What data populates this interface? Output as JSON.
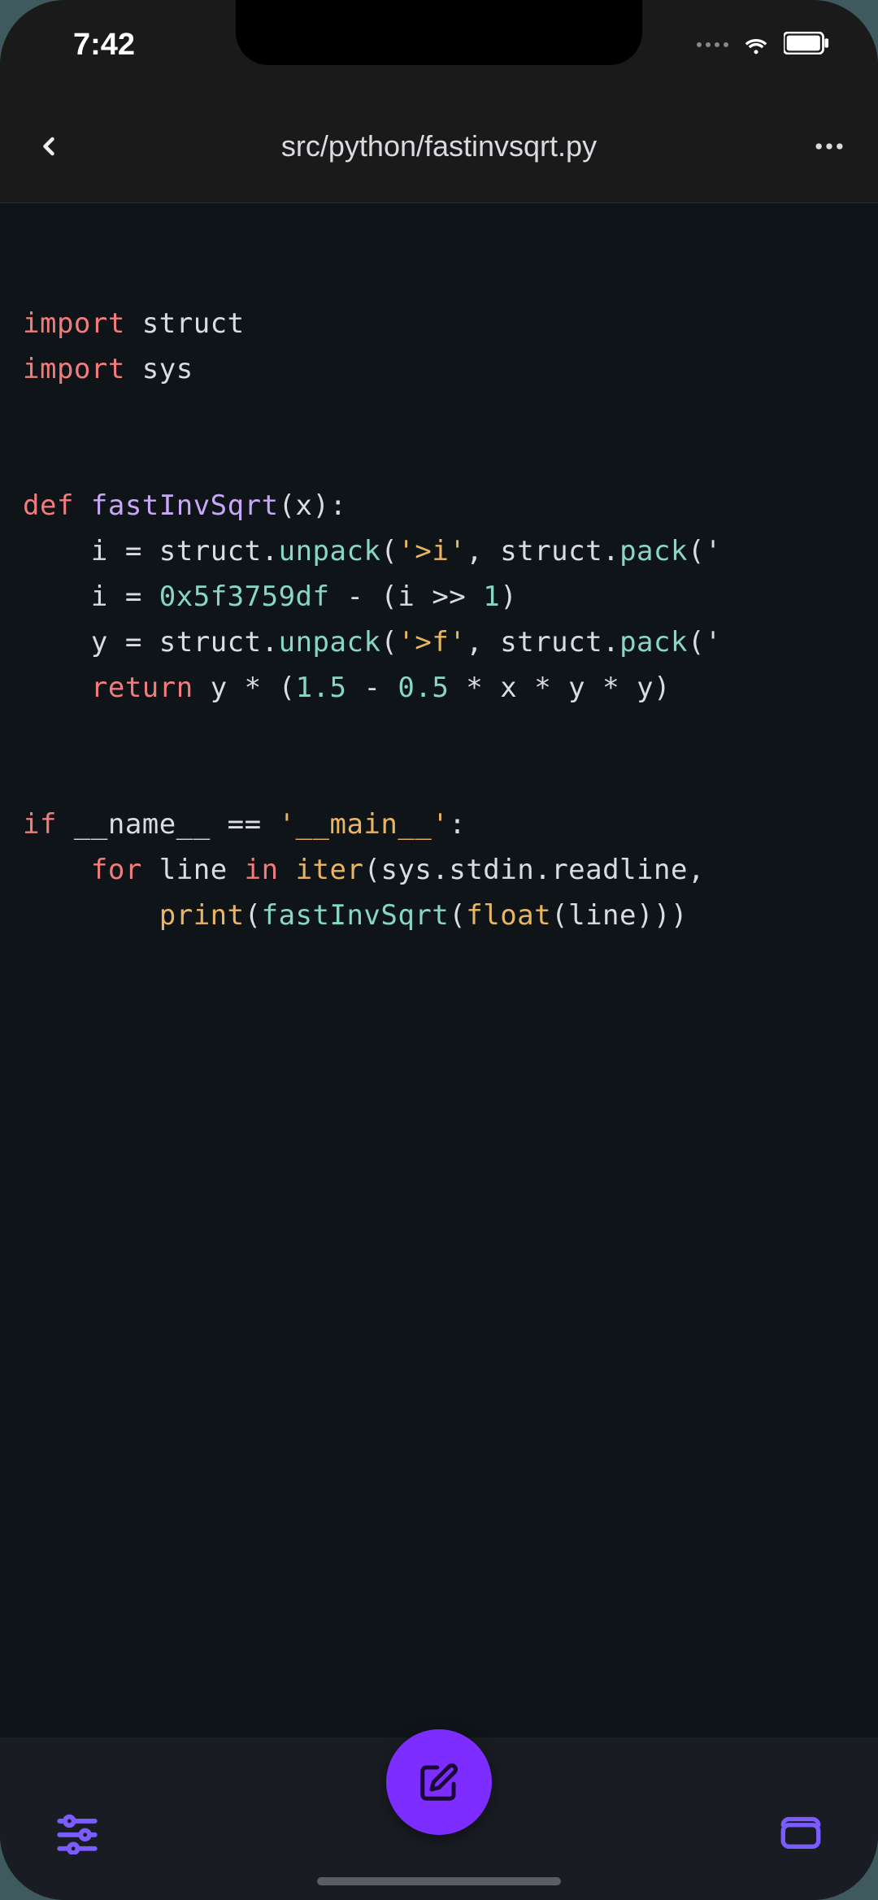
{
  "status": {
    "time": "7:42"
  },
  "nav": {
    "title": "src/python/fastinvsqrt.py"
  },
  "code": {
    "lines": [
      [
        {
          "t": "kw-import",
          "v": "import"
        },
        {
          "t": "ident",
          "v": " struct"
        }
      ],
      [
        {
          "t": "kw-import",
          "v": "import"
        },
        {
          "t": "ident",
          "v": " sys"
        }
      ],
      [],
      [],
      [
        {
          "t": "kw-def",
          "v": "def "
        },
        {
          "t": "func",
          "v": "fastInvSqrt"
        },
        {
          "t": "punct",
          "v": "("
        },
        {
          "t": "ident",
          "v": "x"
        },
        {
          "t": "punct",
          "v": "):"
        }
      ],
      [
        {
          "t": "ident",
          "v": "    i "
        },
        {
          "t": "punct",
          "v": "= "
        },
        {
          "t": "ident",
          "v": "struct"
        },
        {
          "t": "punct",
          "v": "."
        },
        {
          "t": "call",
          "v": "unpack"
        },
        {
          "t": "punct",
          "v": "("
        },
        {
          "t": "str",
          "v": "'>i'"
        },
        {
          "t": "punct",
          "v": ", "
        },
        {
          "t": "ident",
          "v": "struct"
        },
        {
          "t": "punct",
          "v": "."
        },
        {
          "t": "call",
          "v": "pack"
        },
        {
          "t": "punct",
          "v": "('"
        }
      ],
      [
        {
          "t": "ident",
          "v": "    i "
        },
        {
          "t": "punct",
          "v": "= "
        },
        {
          "t": "num",
          "v": "0x5f3759df"
        },
        {
          "t": "punct",
          "v": " - ("
        },
        {
          "t": "ident",
          "v": "i "
        },
        {
          "t": "punct",
          "v": ">> "
        },
        {
          "t": "num",
          "v": "1"
        },
        {
          "t": "punct",
          "v": ")"
        }
      ],
      [
        {
          "t": "ident",
          "v": "    y "
        },
        {
          "t": "punct",
          "v": "= "
        },
        {
          "t": "ident",
          "v": "struct"
        },
        {
          "t": "punct",
          "v": "."
        },
        {
          "t": "call",
          "v": "unpack"
        },
        {
          "t": "punct",
          "v": "("
        },
        {
          "t": "str",
          "v": "'>f'"
        },
        {
          "t": "punct",
          "v": ", "
        },
        {
          "t": "ident",
          "v": "struct"
        },
        {
          "t": "punct",
          "v": "."
        },
        {
          "t": "call",
          "v": "pack"
        },
        {
          "t": "punct",
          "v": "('"
        }
      ],
      [
        {
          "t": "ident",
          "v": "    "
        },
        {
          "t": "kw-return",
          "v": "return"
        },
        {
          "t": "ident",
          "v": " y "
        },
        {
          "t": "punct",
          "v": "* ("
        },
        {
          "t": "num",
          "v": "1.5"
        },
        {
          "t": "punct",
          "v": " - "
        },
        {
          "t": "num",
          "v": "0.5"
        },
        {
          "t": "punct",
          "v": " * "
        },
        {
          "t": "ident",
          "v": "x "
        },
        {
          "t": "punct",
          "v": "* "
        },
        {
          "t": "ident",
          "v": "y "
        },
        {
          "t": "punct",
          "v": "* "
        },
        {
          "t": "ident",
          "v": "y"
        },
        {
          "t": "punct",
          "v": ")"
        }
      ],
      [],
      [],
      [
        {
          "t": "kw-if",
          "v": "if"
        },
        {
          "t": "ident",
          "v": " __name__ "
        },
        {
          "t": "punct",
          "v": "== "
        },
        {
          "t": "str",
          "v": "'__main__'"
        },
        {
          "t": "punct",
          "v": ":"
        }
      ],
      [
        {
          "t": "ident",
          "v": "    "
        },
        {
          "t": "kw-for",
          "v": "for"
        },
        {
          "t": "ident",
          "v": " line "
        },
        {
          "t": "kw-in",
          "v": "in"
        },
        {
          "t": "ident",
          "v": " "
        },
        {
          "t": "builtin",
          "v": "iter"
        },
        {
          "t": "punct",
          "v": "("
        },
        {
          "t": "ident",
          "v": "sys"
        },
        {
          "t": "punct",
          "v": "."
        },
        {
          "t": "ident",
          "v": "stdin"
        },
        {
          "t": "punct",
          "v": "."
        },
        {
          "t": "ident",
          "v": "readline"
        },
        {
          "t": "punct",
          "v": ","
        }
      ],
      [
        {
          "t": "ident",
          "v": "        "
        },
        {
          "t": "builtin",
          "v": "print"
        },
        {
          "t": "punct",
          "v": "("
        },
        {
          "t": "call",
          "v": "fastInvSqrt"
        },
        {
          "t": "punct",
          "v": "("
        },
        {
          "t": "builtin",
          "v": "float"
        },
        {
          "t": "punct",
          "v": "("
        },
        {
          "t": "ident",
          "v": "line"
        },
        {
          "t": "punct",
          "v": ")))"
        }
      ]
    ]
  },
  "icons": {
    "back": "chevron-left-icon",
    "more": "ellipsis-icon",
    "sliders": "sliders-icon",
    "archive": "archive-icon",
    "edit": "edit-icon",
    "wifi": "wifi-icon",
    "battery": "battery-icon"
  },
  "colors": {
    "accent": "#7d2dff",
    "bg": "#0f1419",
    "navbg": "#1a1a1a",
    "bottombg": "#191c22"
  }
}
